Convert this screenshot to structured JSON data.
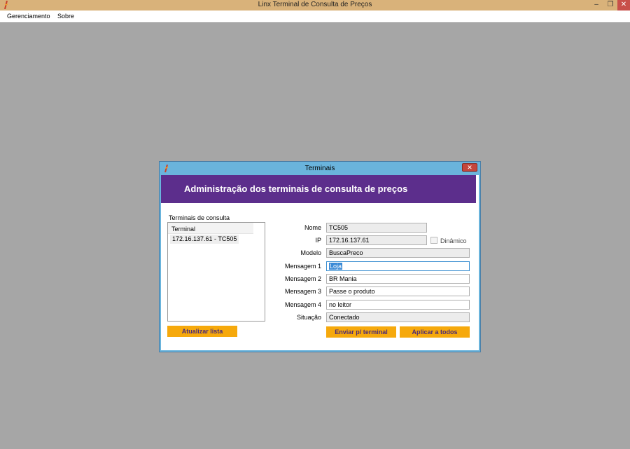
{
  "window": {
    "title": "Linx Terminal de Consulta de Preços",
    "controls": {
      "minimize": "–",
      "maximize": "❐",
      "close": "✕"
    }
  },
  "menu": {
    "items": [
      "Gerenciamento",
      "Sobre"
    ]
  },
  "dialog": {
    "title": "Terminais",
    "close_glyph": "✕",
    "banner": "Administração dos terminais de consulta de preços",
    "list": {
      "label": "Terminais de consulta",
      "column_header": "Terminal",
      "items": [
        "172.16.137.61 - TC505"
      ]
    },
    "fields": {
      "nome": {
        "label": "Nome",
        "value": "TC505"
      },
      "ip": {
        "label": "IP",
        "value": "172.16.137.61"
      },
      "dinamico": {
        "label": "Dinâmico",
        "checked": false
      },
      "modelo": {
        "label": "Modelo",
        "value": "BuscaPreco"
      },
      "mensagem1": {
        "label": "Mensagem 1",
        "value": "Loja"
      },
      "mensagem2": {
        "label": "Mensagem 2",
        "value": "BR Mania"
      },
      "mensagem3": {
        "label": "Mensagem 3",
        "value": "Passe o produto"
      },
      "mensagem4": {
        "label": "Mensagem 4",
        "value": "no leitor"
      },
      "situacao": {
        "label": "Situação",
        "value": "Conectado"
      }
    },
    "buttons": {
      "atualizar": "Atualizar lista",
      "enviar": "Enviar p/ terminal",
      "aplicar": "Aplicar a todos"
    }
  },
  "colors": {
    "banner": "#5c2e8c",
    "button": "#f6a90c",
    "button_text": "#4a2a78",
    "titlebar": "#d9b27a"
  }
}
